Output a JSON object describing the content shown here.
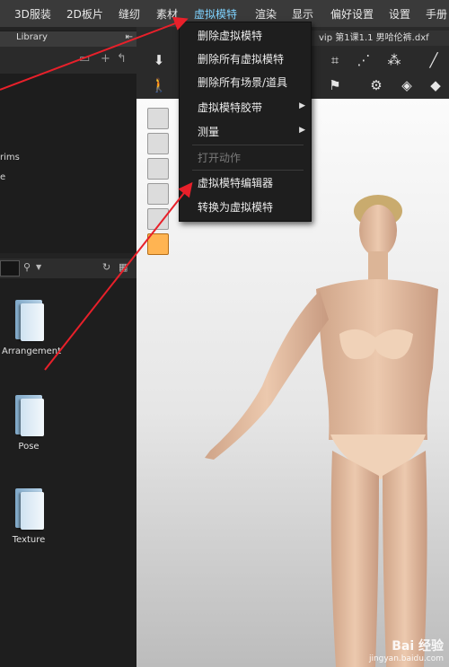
{
  "menubar": {
    "items": [
      "3D服装",
      "2D板片",
      "缝纫",
      "素材",
      "虚拟模特",
      "渲染",
      "显示",
      "偏好设置",
      "设置",
      "手册"
    ]
  },
  "library": {
    "title": "Library",
    "pin_icon": "pin-icon"
  },
  "browser_top": {
    "fragment1": "rims",
    "fragment2": "e"
  },
  "folders": [
    {
      "label": "Arrangement"
    },
    {
      "label": "Pose"
    },
    {
      "label": "Texture"
    }
  ],
  "file_tab": {
    "label": "vip 第1课1.1 男哈伦裤.dxf"
  },
  "dropdown": {
    "items": [
      {
        "label": "删除虚拟模特",
        "submenu": false,
        "disabled": false
      },
      {
        "label": "删除所有虚拟模特",
        "submenu": false,
        "disabled": false
      },
      {
        "label": "删除所有场景/道具",
        "submenu": false,
        "disabled": false
      },
      {
        "label": "虚拟模特胶带",
        "submenu": true,
        "disabled": false
      },
      {
        "label": "测量",
        "submenu": true,
        "disabled": false
      },
      {
        "label": "打开动作",
        "submenu": false,
        "disabled": true
      },
      {
        "label": "虚拟模特编辑器",
        "submenu": false,
        "disabled": false
      },
      {
        "label": "转换为虚拟模特",
        "submenu": false,
        "disabled": false
      }
    ]
  },
  "watermark": {
    "line1": "Bai 经验",
    "line2": "jingyan.baidu.com"
  },
  "colors": {
    "menu_active": "#7fd3ff",
    "annotation_red": "#e8202a",
    "skin": "#e9c2a6"
  }
}
